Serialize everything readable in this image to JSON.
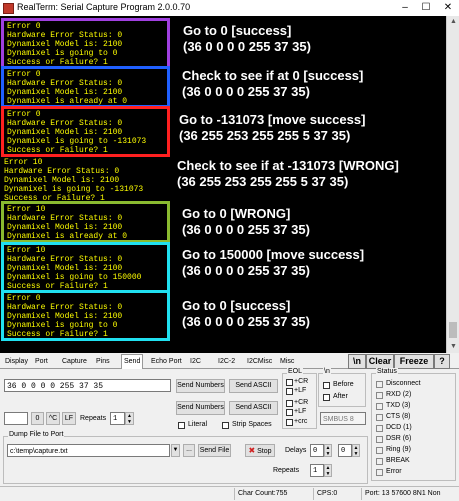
{
  "window": {
    "title": "RealTerm: Serial Capture Program 2.0.0.70",
    "min": "–",
    "max": "☐",
    "close": "✕"
  },
  "terminal": {
    "blocks": [
      {
        "color": "#a040e0",
        "lines": [
          "Error 0",
          "Hardware Error Status: 0",
          "Dynamixel Model is: 2100",
          "Dynamixel is going to 0",
          "Success or Failure? 1"
        ]
      },
      {
        "color": "#2060ff",
        "lines": [
          "Error 0",
          "Hardware Error Status: 0",
          "Dynamixel Model is: 2100",
          "Dynamixel is already at 0"
        ]
      },
      {
        "color": "#ff2020",
        "lines": [
          "Error 0",
          "Hardware Error Status: 0",
          "Dynamixel Model is: 2100",
          "Dynamixel is going to -131073",
          "Success or Failure? 1"
        ]
      },
      {
        "color": "none",
        "lines": [
          "Error 10",
          "Hardware Error Status: 0",
          "Dynamixel Model is: 2100",
          "Dynamixel is going to -131073",
          "Success or Failure? 1"
        ]
      },
      {
        "color": "#8aba30",
        "lines": [
          "Error 10",
          "Hardware Error Status: 0",
          "Dynamixel Model is: 2100",
          "Dynamixel is already at 0"
        ]
      },
      {
        "color": "#20e0f0",
        "lines": [
          "Error 10",
          "Hardware Error Status: 0",
          "Dynamixel Model is: 2100",
          "Dynamixel is going to 150000",
          "Success or Failure? 1"
        ]
      },
      {
        "color": "#20e0f0",
        "lines": [
          "Error 0",
          "Hardware Error Status: 0",
          "Dynamixel Model is: 2100",
          "Dynamixel is going to 0",
          "Success or Failure? 1"
        ]
      }
    ],
    "annotations": [
      {
        "line1": "Go to 0 [success]",
        "line2": "(36 0 0 0 0 255 37 35)"
      },
      {
        "line1": "Check to see if at 0 [success]",
        "line2": "(36 0 0 0 0 255 37 35)"
      },
      {
        "line1": "Go to -131073 [move success]",
        "line2": "(36 255 253 255 255 5 37 35)"
      },
      {
        "line1": "Check to see if at -131073 [WRONG]",
        "line2": "(36 255 253 255 255 5 37 35)"
      },
      {
        "line1": "Go to 0 [WRONG]",
        "line2": "(36 0 0 0 0 255 37 35)"
      },
      {
        "line1": "Go to 150000 [move success]",
        "line2": "(36 0 0 0 0 255 37 35)"
      },
      {
        "line1": "Go to 0 [success]",
        "line2": "(36 0 0 0 0 255 37 35)"
      }
    ],
    "scroll_up": "▲",
    "scroll_down": "▼"
  },
  "tabs": [
    "Display",
    "Port",
    "Capture",
    "Pins",
    "Send",
    "Echo Port",
    "I2C",
    "I2C-2",
    "I2CMisc",
    "Misc"
  ],
  "tab_buttons": {
    "newline": "\\n",
    "clear": "Clear",
    "freeze": "Freeze",
    "help": "?"
  },
  "send": {
    "input1_value": "36 0 0 0 0 255 37 35",
    "input2_value": "",
    "send_numbers": "Send Numbers",
    "send_ascii": "Send ASCII",
    "zero_btn": "0",
    "ctrl_c": "^C",
    "lf": "LF",
    "repeats_label": "Repeats",
    "repeats_value": "1",
    "literal": "Literal",
    "strip_spaces": "Strip Spaces",
    "eol_title": "EOL",
    "eol_options": [
      "+CR",
      "+LF",
      "+CR",
      "+LF",
      "+crc"
    ],
    "n_title": "\\n",
    "before": "Before",
    "after": "After",
    "smbus": "SMBUS 8"
  },
  "dump": {
    "title": "Dump File to Port",
    "path": "c:\\temp\\capture.txt",
    "browse": "...",
    "send_file": "Send File",
    "stop": "Stop",
    "delays_label": "Delays",
    "delay1": "0",
    "delay2": "0",
    "repeats_label": "Repeats",
    "repeats_value": "1"
  },
  "status_panel": {
    "title": "Status",
    "items": [
      "Disconnect",
      "RXD (2)",
      "TXD (3)",
      "CTS (8)",
      "DCD (1)",
      "DSR (6)",
      "Ring (9)",
      "BREAK",
      "Error"
    ]
  },
  "statusbar": {
    "char_count": "Char Count:755",
    "cps": "CPS:0",
    "port": "Port: 13 57600 8N1 Non"
  }
}
